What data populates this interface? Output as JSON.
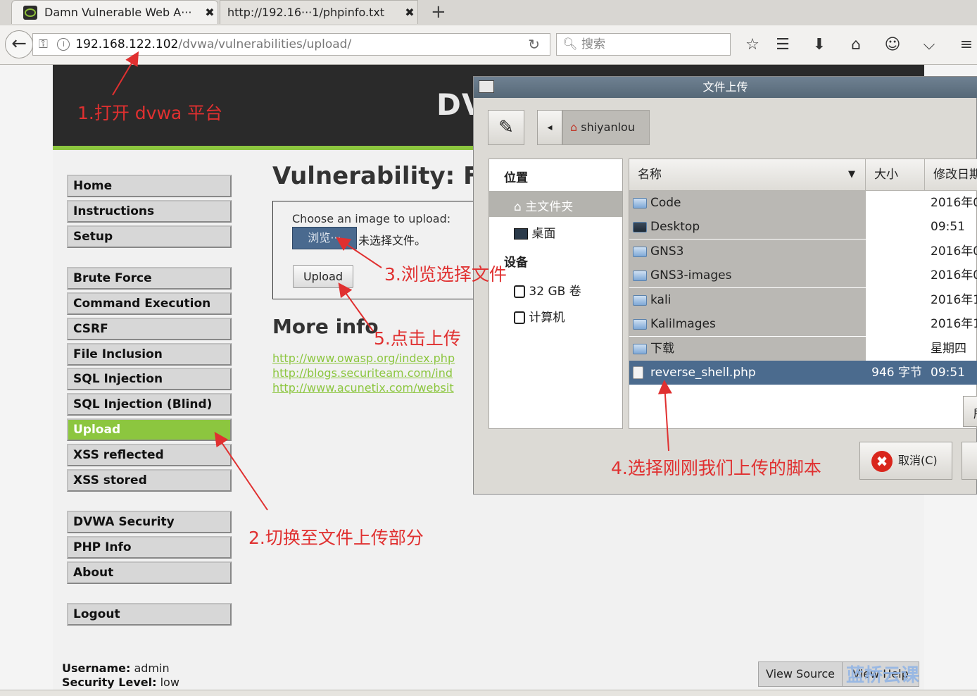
{
  "browser": {
    "tabs": [
      {
        "title": "Damn Vulnerable Web A···",
        "close": "✖"
      },
      {
        "title": "http://192.16···1/phpinfo.txt",
        "close": "✖"
      }
    ],
    "new_tab": "+",
    "url_host": "192.168.122.102",
    "url_path": "/dvwa/vulnerabilities/upload/",
    "search_placeholder": "搜索"
  },
  "dvwa": {
    "logo_partial": "DV",
    "menu": {
      "home": "Home",
      "instructions": "Instructions",
      "setup": "Setup",
      "brute_force": "Brute Force",
      "command_execution": "Command Execution",
      "csrf": "CSRF",
      "file_inclusion": "File Inclusion",
      "sql_injection": "SQL Injection",
      "sql_injection_blind": "SQL Injection (Blind)",
      "upload": "Upload",
      "xss_reflected": "XSS reflected",
      "xss_stored": "XSS stored",
      "dvwa_security": "DVWA Security",
      "php_info": "PHP Info",
      "about": "About",
      "logout": "Logout"
    },
    "heading": "Vulnerability: File",
    "choose_label": "Choose an image to upload:",
    "browse_label": "浏览···",
    "no_file": "未选择文件。",
    "upload_label": "Upload",
    "more_info": "More info",
    "links": [
      "http://www.owasp.org/index.php",
      "http://blogs.securiteam.com/ind",
      "http://www.acunetix.com/websit"
    ],
    "username_label": "Username:",
    "username": "admin",
    "security_label": "Security Level:",
    "security": "low",
    "view_source": "View Source",
    "view_help": "View Help",
    "accent_color": "#8cc63f"
  },
  "dialog": {
    "title": "文件上传",
    "path_button": "shiyanlou",
    "places_header": "位置",
    "places": [
      "主文件夹",
      "桌面"
    ],
    "devices_header": "设备",
    "devices": [
      "32 GB 卷",
      "计算机"
    ],
    "columns": {
      "name": "名称",
      "size": "大小",
      "modified": "修改日期"
    },
    "files": [
      {
        "name": "Code",
        "size": "",
        "modified": "2016年0"
      },
      {
        "name": "Desktop",
        "size": "",
        "modified": "09:51"
      },
      {
        "name": "GNS3",
        "size": "",
        "modified": "2016年0"
      },
      {
        "name": "GNS3-images",
        "size": "",
        "modified": "2016年0"
      },
      {
        "name": "kali",
        "size": "",
        "modified": "2016年1"
      },
      {
        "name": "KaliImages",
        "size": "",
        "modified": "2016年1"
      },
      {
        "name": "下载",
        "size": "",
        "modified": "星期四"
      },
      {
        "name": "reverse_shell.php",
        "size": "946 字节",
        "modified": "09:51"
      }
    ],
    "cancel_label": "取消(C)",
    "side_button_partial": "所"
  },
  "annotations": {
    "step1": "1.打开 dvwa 平台",
    "step2": "2.切换至文件上传部分",
    "step3": "3.浏览选择文件",
    "step4": "4.选择刚刚我们上传的脚本",
    "step5": "5.点击上传",
    "color": "#e03030"
  },
  "watermark": "蓝桥云课"
}
